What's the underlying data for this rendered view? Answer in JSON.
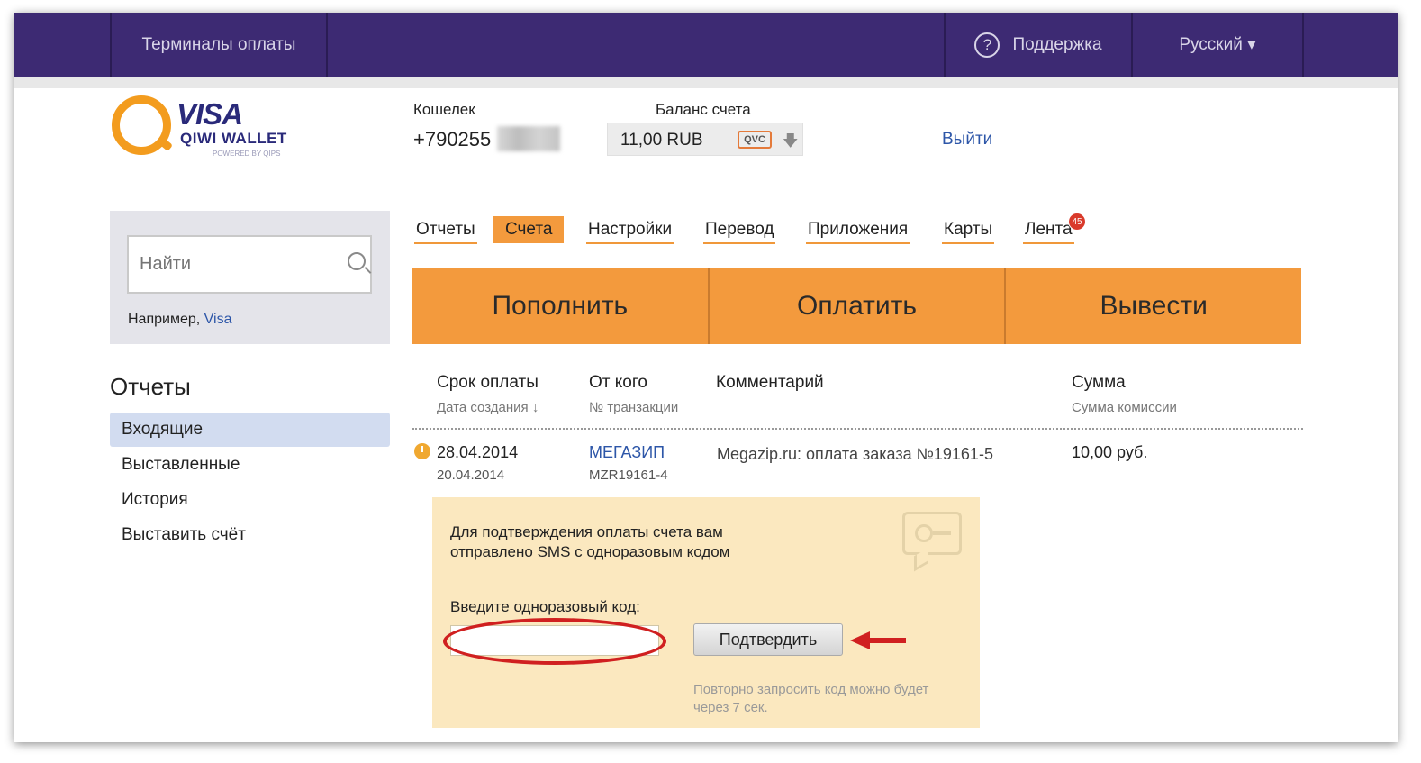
{
  "topbar": {
    "terminals": "Терминалы оплаты",
    "help_icon_glyph": "?",
    "support": "Поддержка",
    "language": "Русский ▾"
  },
  "logo": {
    "visa": "VISA",
    "qiwi": "QIWI WALLET",
    "powered": "POWERED BY QIPS"
  },
  "wallet": {
    "label": "Кошелек",
    "number": "+790255"
  },
  "balance": {
    "label": "Баланс счета",
    "value": "11,00 RUB",
    "currency_badge": "QVC",
    "arrow": "🡇"
  },
  "logout": "Выйти",
  "search": {
    "placeholder": "Найти",
    "example_prefix": "Например, ",
    "example_link": "Visa"
  },
  "sidebar": {
    "title": "Отчеты",
    "items": [
      {
        "label": "Входящие",
        "active": true
      },
      {
        "label": "Выставленные"
      },
      {
        "label": "История"
      },
      {
        "label": "Выставить счёт"
      }
    ]
  },
  "tabs": [
    {
      "label": "Отчеты"
    },
    {
      "label": "Счета",
      "active": true
    },
    {
      "label": "Настройки"
    },
    {
      "label": "Перевод"
    },
    {
      "label": "Приложения"
    },
    {
      "label": "Карты"
    },
    {
      "label": "Лента"
    }
  ],
  "feed_badge": "45",
  "actions": {
    "topup": "Пополнить",
    "pay": "Оплатить",
    "withdraw": "Вывести"
  },
  "table": {
    "headers": {
      "due_date": "Срок оплаты",
      "created_date": "Дата создания ↓",
      "from": "От кого",
      "txn": "№ транзакции",
      "comment": "Комментарий",
      "amount": "Сумма",
      "fee": "Сумма комиссии"
    },
    "row": {
      "due_date": "28.04.2014",
      "created_date": "20.04.2014",
      "from": "МЕГАЗИП",
      "txn": "MZR19161-4",
      "comment": "Megazip.ru: оплата заказа №19161-5",
      "amount": "10,00 руб."
    }
  },
  "sms": {
    "message_line1": "Для подтверждения оплаты счета вам",
    "message_line2": "отправлено SMS с одноразовым кодом",
    "code_label": "Введите одноразовый код:",
    "code_value": "",
    "confirm": "Подтвердить",
    "resend_line1": "Повторно запросить код можно будет",
    "resend_line2": "через 7 сек."
  },
  "colors": {
    "topbar": "#3d2a73",
    "accent_orange": "#f39a3d",
    "link_blue": "#2d56a8",
    "sms_box": "#fbe8bf",
    "highlight_red": "#d02020"
  }
}
